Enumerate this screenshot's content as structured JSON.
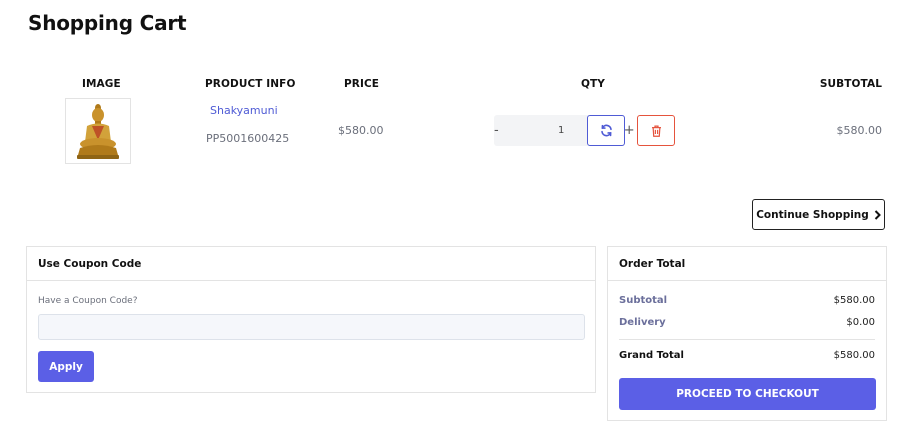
{
  "page": {
    "title": "Shopping Cart"
  },
  "table": {
    "headers": {
      "image": "IMAGE",
      "product_info": "PRODUCT INFO",
      "price": "PRICE",
      "qty": "QTY",
      "subtotal": "SUBTOTAL"
    }
  },
  "cart_item": {
    "name": "Shakyamuni",
    "sku": "PP5001600425",
    "price": "$580.00",
    "quantity": "1",
    "subtotal": "$580.00",
    "image_icon": "buddha-statue-icon"
  },
  "qty_controls": {
    "decrement": "-",
    "increment": "+",
    "refresh_icon": "refresh-icon",
    "delete_icon": "trash-icon"
  },
  "continue_shopping": {
    "label": "Continue Shopping",
    "icon": "chevron-right-icon"
  },
  "coupon": {
    "title": "Use Coupon Code",
    "label": "Have a Coupon Code?",
    "input_value": "",
    "placeholder": "",
    "apply_label": "Apply"
  },
  "order_total": {
    "title": "Order Total",
    "subtotal_label": "Subtotal",
    "subtotal_value": "$580.00",
    "delivery_label": "Delivery",
    "delivery_value": "$0.00",
    "grand_label": "Grand Total",
    "grand_value": "$580.00",
    "checkout_label": "PROCEED TO CHECKOUT"
  },
  "colors": {
    "accent": "#5b5fe6",
    "link": "#4f5bd5",
    "danger": "#e5533d",
    "muted": "#6b6f7b"
  }
}
